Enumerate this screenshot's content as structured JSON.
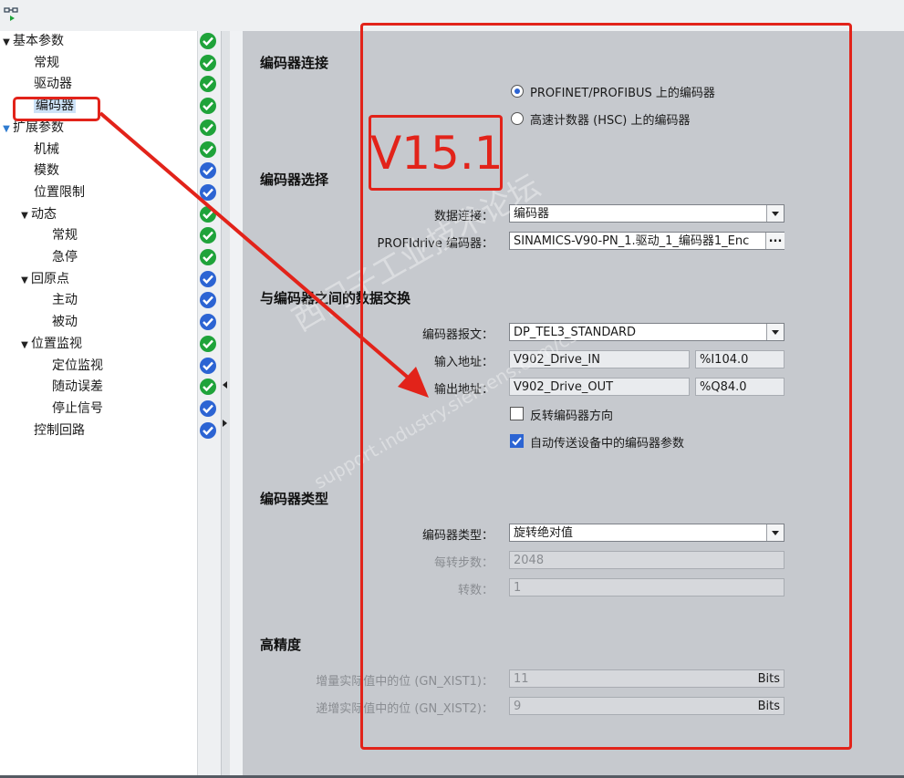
{
  "tree": {
    "items": [
      {
        "label": "基本参数",
        "level": 0,
        "caret": "▼",
        "status": "green"
      },
      {
        "label": "常规",
        "level": 1,
        "caret": "",
        "status": "green"
      },
      {
        "label": "驱动器",
        "level": 1,
        "caret": "",
        "status": "green"
      },
      {
        "label": "编码器",
        "level": 1,
        "caret": "",
        "status": "green",
        "selected": true
      },
      {
        "label": "扩展参数",
        "level": 0,
        "caret": "▼",
        "status": "green"
      },
      {
        "label": "机械",
        "level": 1,
        "caret": "",
        "status": "green"
      },
      {
        "label": "模数",
        "level": 1,
        "caret": "",
        "status": "blue"
      },
      {
        "label": "位置限制",
        "level": 1,
        "caret": "",
        "status": "blue"
      },
      {
        "label": "动态",
        "level": 1,
        "caret": "▼",
        "status": "green"
      },
      {
        "label": "常规",
        "level": 2,
        "caret": "",
        "status": "green"
      },
      {
        "label": "急停",
        "level": 2,
        "caret": "",
        "status": "green"
      },
      {
        "label": "回原点",
        "level": 1,
        "caret": "▼",
        "status": "blue"
      },
      {
        "label": "主动",
        "level": 2,
        "caret": "",
        "status": "blue"
      },
      {
        "label": "被动",
        "level": 2,
        "caret": "",
        "status": "blue"
      },
      {
        "label": "位置监视",
        "level": 1,
        "caret": "▼",
        "status": "green"
      },
      {
        "label": "定位监视",
        "level": 2,
        "caret": "",
        "status": "blue"
      },
      {
        "label": "随动误差",
        "level": 2,
        "caret": "",
        "status": "green"
      },
      {
        "label": "停止信号",
        "level": 2,
        "caret": "",
        "status": "blue"
      },
      {
        "label": "控制回路",
        "level": 1,
        "caret": "",
        "status": "blue"
      }
    ]
  },
  "annotation": {
    "version_text": "V15.1"
  },
  "encoder_connection": {
    "title": "编码器连接",
    "option_profinet": "PROFINET/PROFIBUS 上的编码器",
    "option_hsc": "高速计数器 (HSC) 上的编码器"
  },
  "encoder_selection": {
    "title": "编码器选择",
    "data_link_label": "数据连接：",
    "data_link_value": "编码器",
    "profidrive_label": "PROFIdrive 编码器：",
    "profidrive_value": "SINAMICS-V90-PN_1.驱动_1_编码器1_Enc",
    "browse_label": "..."
  },
  "data_exchange": {
    "title": "与编码器之间的数据交换",
    "telegram_label": "编码器报文：",
    "telegram_value": "DP_TEL3_STANDARD",
    "input_label": "输入地址：",
    "input_name": "V902_Drive_IN",
    "input_addr": "%I104.0",
    "output_label": "输出地址：",
    "output_name": "V902_Drive_OUT",
    "output_addr": "%Q84.0",
    "invert_label": "反转编码器方向",
    "auto_label": "自动传送设备中的编码器参数"
  },
  "encoder_type": {
    "title": "编码器类型",
    "type_label": "编码器类型：",
    "type_value": "旋转绝对值",
    "steps_label": "每转步数：",
    "steps_value": "2048",
    "revs_label": "转数：",
    "revs_value": "1"
  },
  "high_precision": {
    "title": "高精度",
    "incr_label": "增量实际值中的位 (GN_XIST1)：",
    "incr_value": "11",
    "incr_unit": "Bits",
    "abs_label": "递增实际值中的位 (GN_XIST2)：",
    "abs_value": "9",
    "abs_unit": "Bits"
  },
  "watermark": {
    "line1": "西门子工业技术论坛",
    "line2": "support.industry.siemens.com/cs"
  },
  "colors": {
    "annotation_red": "#e2231a",
    "status_green": "#1fa33a",
    "status_blue": "#2c64d3"
  }
}
